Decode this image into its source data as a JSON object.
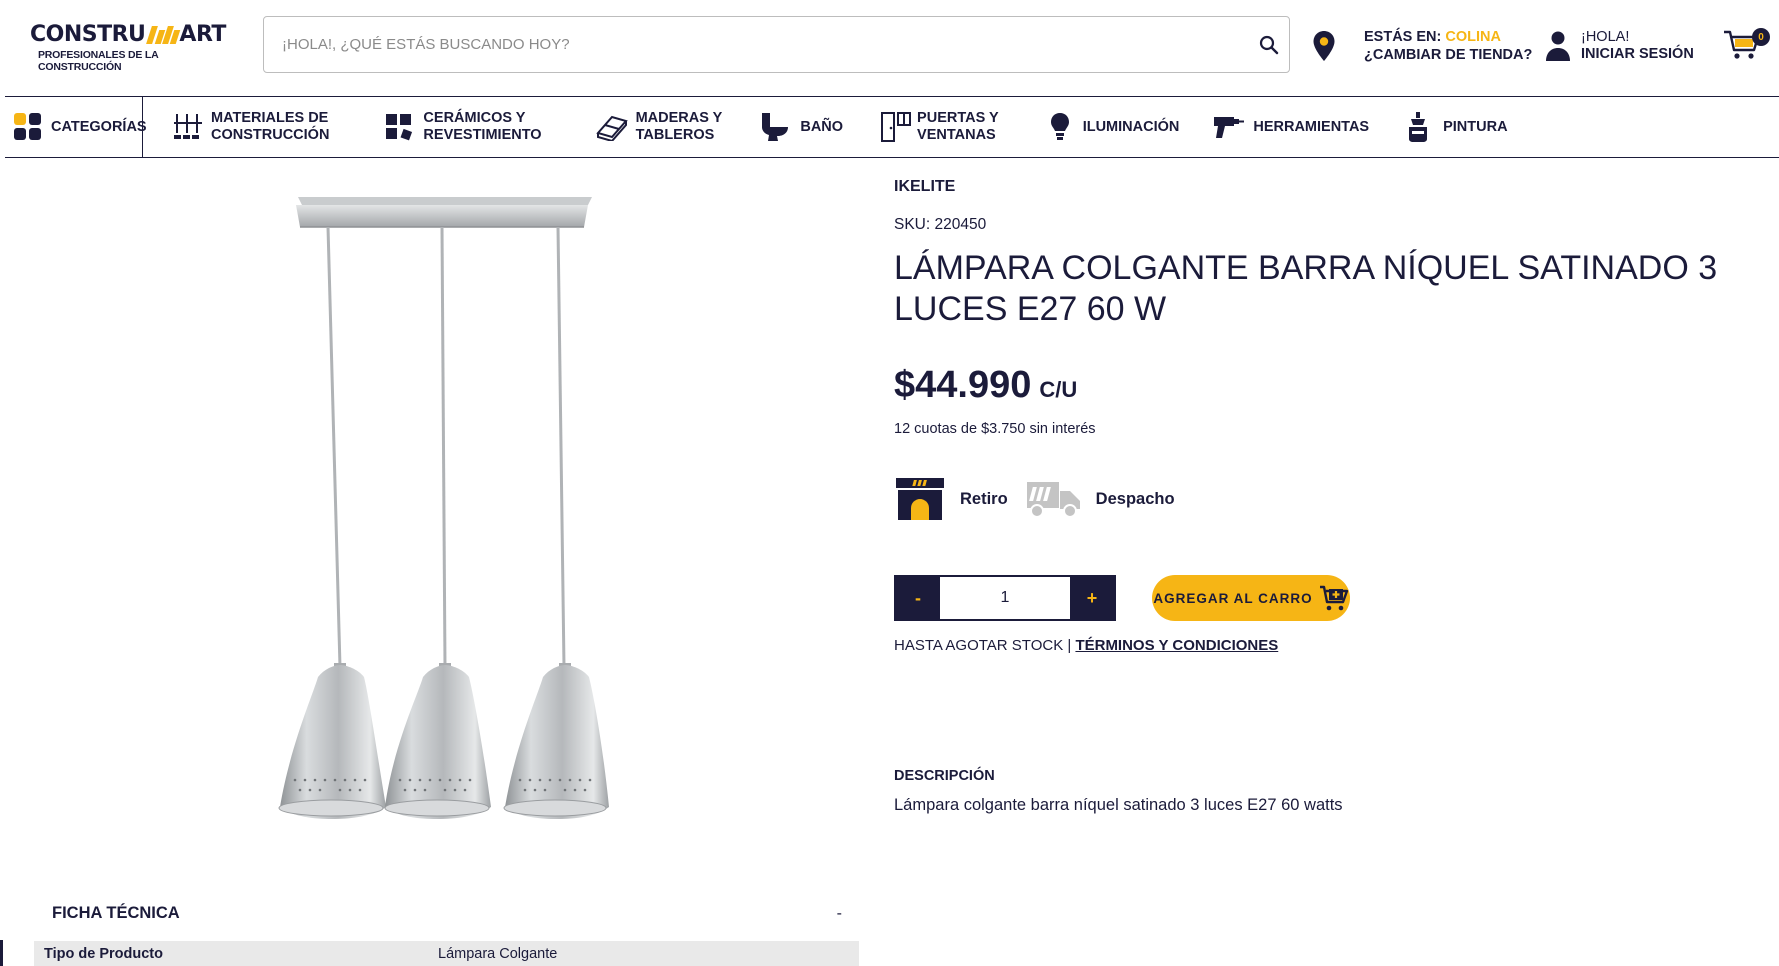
{
  "header": {
    "logo_text_left": "CONSTRU",
    "logo_text_right": "ART",
    "logo_tagline": "PROFESIONALES DE LA CONSTRUCCIÓN",
    "search_placeholder": "¡HOLA!, ¿QUÉ ESTÁS BUSCANDO HOY?",
    "store_prefix": "ESTÁS EN: ",
    "store_name": "COLINA",
    "store_change": "¿CAMBIAR DE TIENDA?",
    "login_greeting": "¡HOLA!",
    "login_label": "INICIAR SESIÓN",
    "cart_count": "0",
    "accent_color": "#f6b515",
    "brand_color": "#1b1b3a"
  },
  "nav": {
    "categories_label": "CATEGORÍAS",
    "items": [
      {
        "label_1": "MATERIALES DE",
        "label_2": "CONSTRUCCIÓN",
        "icon": "bricks-icon"
      },
      {
        "label_1": "CERÁMICOS Y",
        "label_2": "REVESTIMIENTO",
        "icon": "tiles-icon"
      },
      {
        "label_1": "MADERAS Y",
        "label_2": "TABLEROS",
        "icon": "wood-icon"
      },
      {
        "label_1": "BAÑO",
        "label_2": "",
        "icon": "toilet-icon"
      },
      {
        "label_1": "PUERTAS Y",
        "label_2": "VENTANAS",
        "icon": "door-icon"
      },
      {
        "label_1": "ILUMINACIÓN",
        "label_2": "",
        "icon": "bulb-icon"
      },
      {
        "label_1": "HERRAMIENTAS",
        "label_2": "",
        "icon": "drill-icon"
      },
      {
        "label_1": "PINTURA",
        "label_2": "",
        "icon": "paint-icon"
      }
    ]
  },
  "product": {
    "brand": "IKELITE",
    "sku": "SKU: 220450",
    "title": "LÁMPARA COLGANTE BARRA NÍQUEL SATINADO 3 LUCES E27 60 W",
    "price": "$44.990",
    "unit": "C/U",
    "installments": "12 cuotas de $3.750 sin interés",
    "pickup_label": "Retiro",
    "delivery_label": "Despacho",
    "quantity": "1",
    "qty_minus": "-",
    "qty_plus": "+",
    "add_to_cart": "AGREGAR AL CARRO",
    "stock_text": "HASTA AGOTAR STOCK | ",
    "terms_link": "TÉRMINOS Y CONDICIONES",
    "description_heading": "DESCRIPCIÓN",
    "description": "Lámpara colgante barra níquel satinado 3 luces E27 60 watts"
  },
  "ficha": {
    "heading": "FICHA TÉCNICA",
    "toggle": "-",
    "rows": [
      {
        "key": "Tipo de Producto",
        "value": "Lámpara Colgante"
      }
    ]
  }
}
